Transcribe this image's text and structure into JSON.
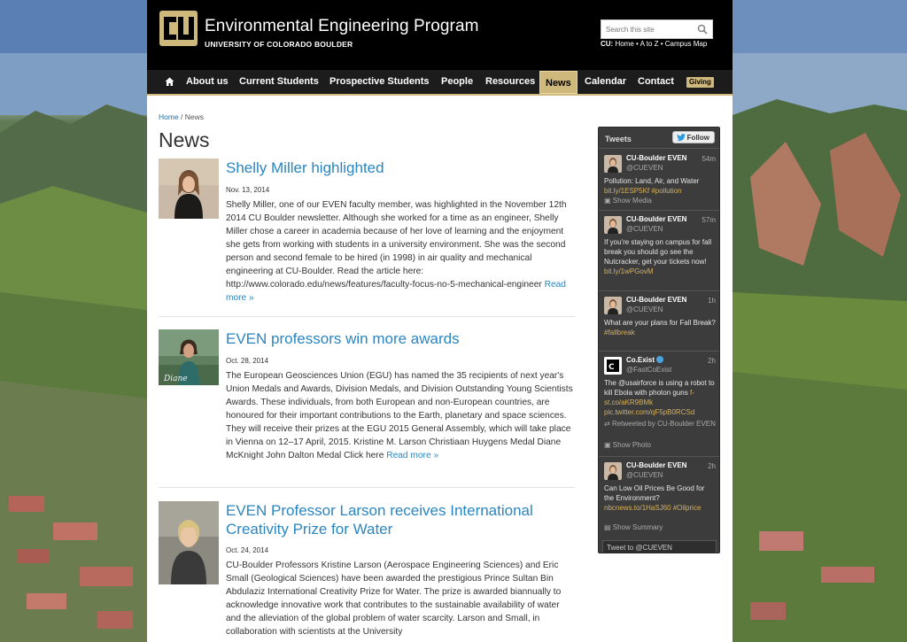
{
  "header": {
    "title": "Environmental Engineering Program",
    "subtitle_prefix": "UNIVERSITY OF COLORADO",
    "subtitle_bold": "BOULDER",
    "search_placeholder": "Search this site",
    "cu_label": "CU:",
    "cu_links": "Home • A to Z • Campus Map"
  },
  "nav": {
    "items": [
      "About us",
      "Current Students",
      "Prospective Students",
      "People",
      "Resources",
      "News",
      "Calendar",
      "Contact"
    ],
    "active": "News",
    "giving": "Giving"
  },
  "breadcrumb": {
    "home": "Home",
    "separator": " / ",
    "current": "News"
  },
  "page_title": "News",
  "articles": [
    {
      "title": "Shelly Miller highlighted",
      "date": "Nov. 13, 2014",
      "body": "Shelly Miller, one of our EVEN faculty member, was highlighted in the November 12th 2014 CU Boulder newsletter. Although she worked for a time as an engineer, Shelly Miller chose a career in academia because of her love of learning and the enjoyment she gets from working with students in a university environment. She was the second person and second female to be hired (in 1998) in air quality and mechanical engineering at CU-Boulder. Read the article here: http://www.colorado.edu/news/features/faculty-focus-no-5-mechanical-engineer",
      "more": "Read more »"
    },
    {
      "title": "EVEN professors win more awards",
      "date": "Oct. 28, 2014",
      "body": "The European Geosciences Union (EGU) has named the 35 recipients of next year's Union Medals and Awards, Division Medals, and Division Outstanding Young Scientists Awards. These individuals, from both European and non-European countries, are honoured for their important contributions to the Earth, planetary and space sciences. They will receive their prizes at the EGU 2015 General Assembly, which will take place in Vienna on 12–17 April, 2015. Kristine M. Larson Christiaan Huygens Medal Diane McKnight John Dalton Medal Click here",
      "more": "Read more »"
    },
    {
      "title": "EVEN Professor Larson receives International Creativity Prize for Water",
      "date": "Oct. 24, 2014",
      "body": "CU-Boulder Professors Kristine Larson (Aerospace Engineering Sciences) and Eric Small (Geological Sciences) have been awarded the prestigious Prince Sultan Bin Abdulaziz International Creativity Prize for Water. The prize is awarded biannually to acknowledge innovative work that contributes to the sustainable availability of water and the alleviation of the global problem of water scarcity. Larson and Small, in collaboration with scientists at the University",
      "more": ""
    }
  ],
  "tweets_widget": {
    "title": "Tweets",
    "follow": "Follow",
    "tweet_to": "Tweet to @CUEVEN",
    "tweets": [
      {
        "name": "CU-Boulder EVEN",
        "handle": "@CUEVEN",
        "time": "54m",
        "text": "Pollution: Land, Air, and Water",
        "link": "bit.ly/1ESP5Kf  #pollution",
        "extra": "Show Media"
      },
      {
        "name": "CU-Boulder EVEN",
        "handle": "@CUEVEN",
        "time": "57m",
        "text": "If you're staying on campus for fall break you should go see the Nutcracker, get your tickets now!",
        "link": "bit.ly/1wPGovM",
        "extra": ""
      },
      {
        "name": "CU-Boulder EVEN",
        "handle": "@CUEVEN",
        "time": "1h",
        "text": "What are your plans for Fall Break?",
        "link": "#fallbreak",
        "extra": ""
      },
      {
        "name": "Co.Exist",
        "handle": "@FastCoExist",
        "time": "2h",
        "text": "The @usairforce is using a robot to kill Ebola with photon guns",
        "link": "f-st.co/aKR9BMk pic.twitter.com/qF5pB0RCSd",
        "extra": "Retweeted by CU-Boulder EVEN",
        "extra2": "Show Photo"
      },
      {
        "name": "CU-Boulder EVEN",
        "handle": "@CUEVEN",
        "time": "2h",
        "text": "Can Low Oil Prices Be Good for the Environment?",
        "link": "nbcnews.to/1HaSJ60 #Oilprice",
        "extra": "Show Summary"
      }
    ]
  },
  "colors": {
    "gold": "#cfb87c",
    "link_blue": "#2a86c0",
    "nav_bg": "#1c1c1c"
  }
}
